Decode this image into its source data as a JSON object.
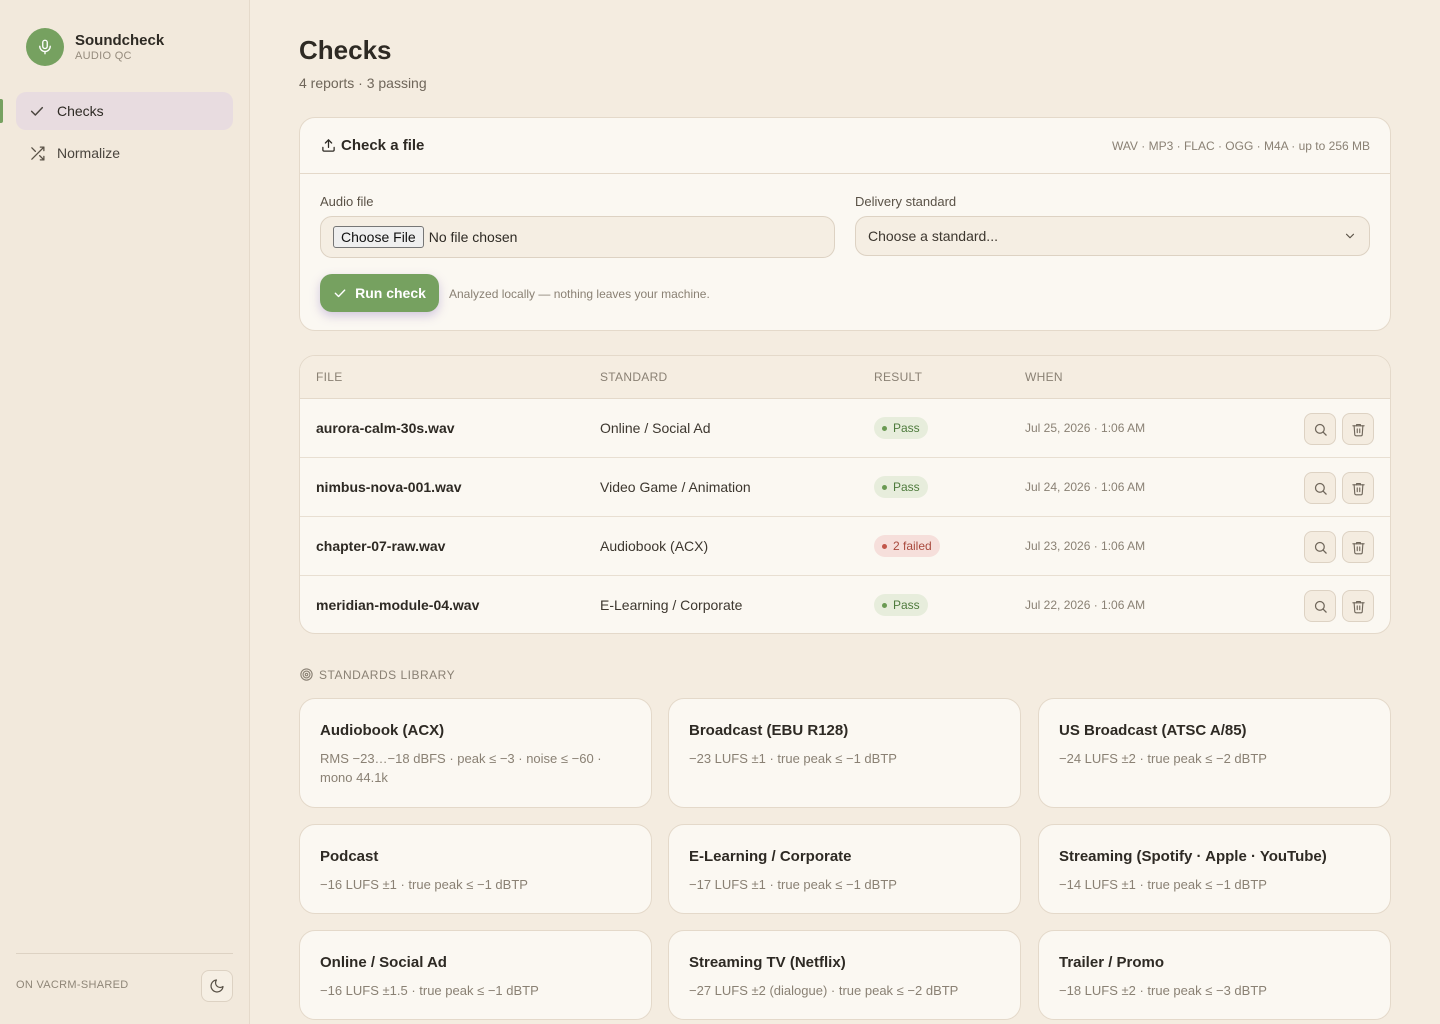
{
  "brand": {
    "name": "Soundcheck",
    "subtitle": "AUDIO QC"
  },
  "nav": [
    {
      "label": "Checks",
      "icon": "check-icon",
      "active": true
    },
    {
      "label": "Normalize",
      "icon": "shuffle-icon",
      "active": false
    }
  ],
  "footer": {
    "workspace": "ON VACRM-SHARED",
    "theme_icon": "moon-icon"
  },
  "page": {
    "title": "Checks",
    "subtitle": "4 reports · 3 passing"
  },
  "upload": {
    "title": "Check a file",
    "formats": "WAV · MP3 · FLAC · OGG · M4A · up to 256 MB",
    "file_label": "Audio file",
    "choose_label": "Choose File",
    "file_status": "No file chosen",
    "standard_label": "Delivery standard",
    "standard_placeholder": "Choose a standard...",
    "run_label": "Run check",
    "note": "Analyzed locally — nothing leaves your machine."
  },
  "table": {
    "headers": {
      "file": "FILE",
      "standard": "STANDARD",
      "result": "RESULT",
      "when": "WHEN"
    },
    "rows": [
      {
        "file": "aurora-calm-30s.wav",
        "standard": "Online / Social Ad",
        "result": "Pass",
        "status": "pass",
        "when": "Jul 25, 2026 · 1:06 AM"
      },
      {
        "file": "nimbus-nova-001.wav",
        "standard": "Video Game / Animation",
        "result": "Pass",
        "status": "pass",
        "when": "Jul 24, 2026 · 1:06 AM"
      },
      {
        "file": "chapter-07-raw.wav",
        "standard": "Audiobook (ACX)",
        "result": "2 failed",
        "status": "fail",
        "when": "Jul 23, 2026 · 1:06 AM"
      },
      {
        "file": "meridian-module-04.wav",
        "standard": "E-Learning / Corporate",
        "result": "Pass",
        "status": "pass",
        "when": "Jul 22, 2026 · 1:06 AM"
      }
    ]
  },
  "library": {
    "heading": "STANDARDS LIBRARY",
    "standards": [
      {
        "name": "Audiobook (ACX)",
        "spec": "RMS −23…−18 dBFS · peak ≤ −3 · noise ≤ −60 · mono 44.1k"
      },
      {
        "name": "Broadcast (EBU R128)",
        "spec": "−23 LUFS ±1 · true peak ≤ −1 dBTP"
      },
      {
        "name": "US Broadcast (ATSC A/85)",
        "spec": "−24 LUFS ±2 · true peak ≤ −2 dBTP"
      },
      {
        "name": "Podcast",
        "spec": "−16 LUFS ±1 · true peak ≤ −1 dBTP"
      },
      {
        "name": "E-Learning / Corporate",
        "spec": "−17 LUFS ±1 · true peak ≤ −1 dBTP"
      },
      {
        "name": "Streaming (Spotify · Apple · YouTube)",
        "spec": "−14 LUFS ±1 · true peak ≤ −1 dBTP"
      },
      {
        "name": "Online / Social Ad",
        "spec": "−16 LUFS ±1.5 · true peak ≤ −1 dBTP"
      },
      {
        "name": "Streaming TV (Netflix)",
        "spec": "−27 LUFS ±2 (dialogue) · true peak ≤ −2 dBTP"
      },
      {
        "name": "Trailer / Promo",
        "spec": "−18 LUFS ±2 · true peak ≤ −3 dBTP"
      }
    ]
  },
  "colors": {
    "accent": "#76a160",
    "background": "#f4ece0",
    "pass": "#4e7a3c",
    "fail": "#a94a3e"
  }
}
